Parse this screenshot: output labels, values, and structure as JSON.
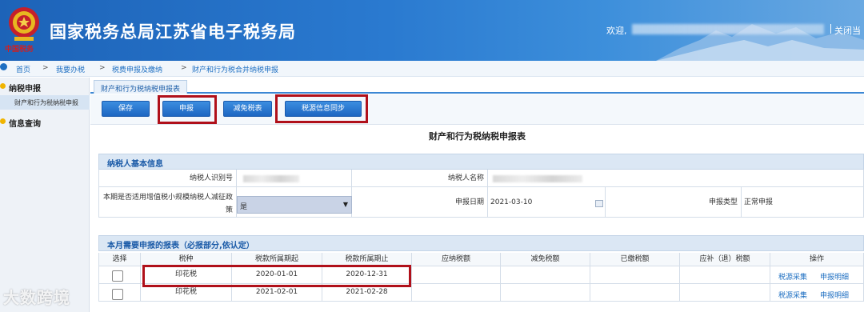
{
  "header": {
    "site_title": "国家税务总局江苏省电子税务局",
    "brand_sub": "中国税务",
    "welcome": "欢迎,",
    "close_label": "关闭当"
  },
  "breadcrumb": [
    "首页",
    "我要办税",
    "税费申报及缴纳",
    "财产和行为税合并纳税申报"
  ],
  "breadcrumb_sep": ">",
  "sidebar": {
    "section1": "纳税申报",
    "sub1": "财产和行为税纳税申报",
    "section2": "信息查询"
  },
  "tab": "财产和行为税纳税申报表",
  "toolbar": {
    "save": "保存",
    "declare": "申报",
    "reduce": "减免税表",
    "sync": "税源信息同步"
  },
  "form_title": "财产和行为税纳税申报表",
  "basic": {
    "title": "纳税人基本信息",
    "taxpayer_id_label": "纳税人识别号",
    "taxpayer_name_label": "纳税人名称",
    "policy_label": "本期是否适用增值税小规模纳税人减征政策",
    "policy_value": "是",
    "date_label": "申报日期",
    "date_value": "2021-03-10",
    "type_label": "申报类型",
    "type_value": "正常申报"
  },
  "table": {
    "title": "本月需要申报的报表（必报部分,依认定）",
    "headers": [
      "选择",
      "税种",
      "税款所属期起",
      "税款所属期止",
      "应纳税额",
      "减免税额",
      "已缴税额",
      "应补（退）税额",
      "操作"
    ],
    "rows": [
      {
        "tax": "印花税",
        "start": "2020-01-01",
        "end": "2020-12-31"
      },
      {
        "tax": "印花税",
        "start": "2021-02-01",
        "end": "2021-02-28"
      }
    ],
    "op1": "税源采集",
    "op2": "申报明细"
  },
  "watermark": "大数跨境"
}
